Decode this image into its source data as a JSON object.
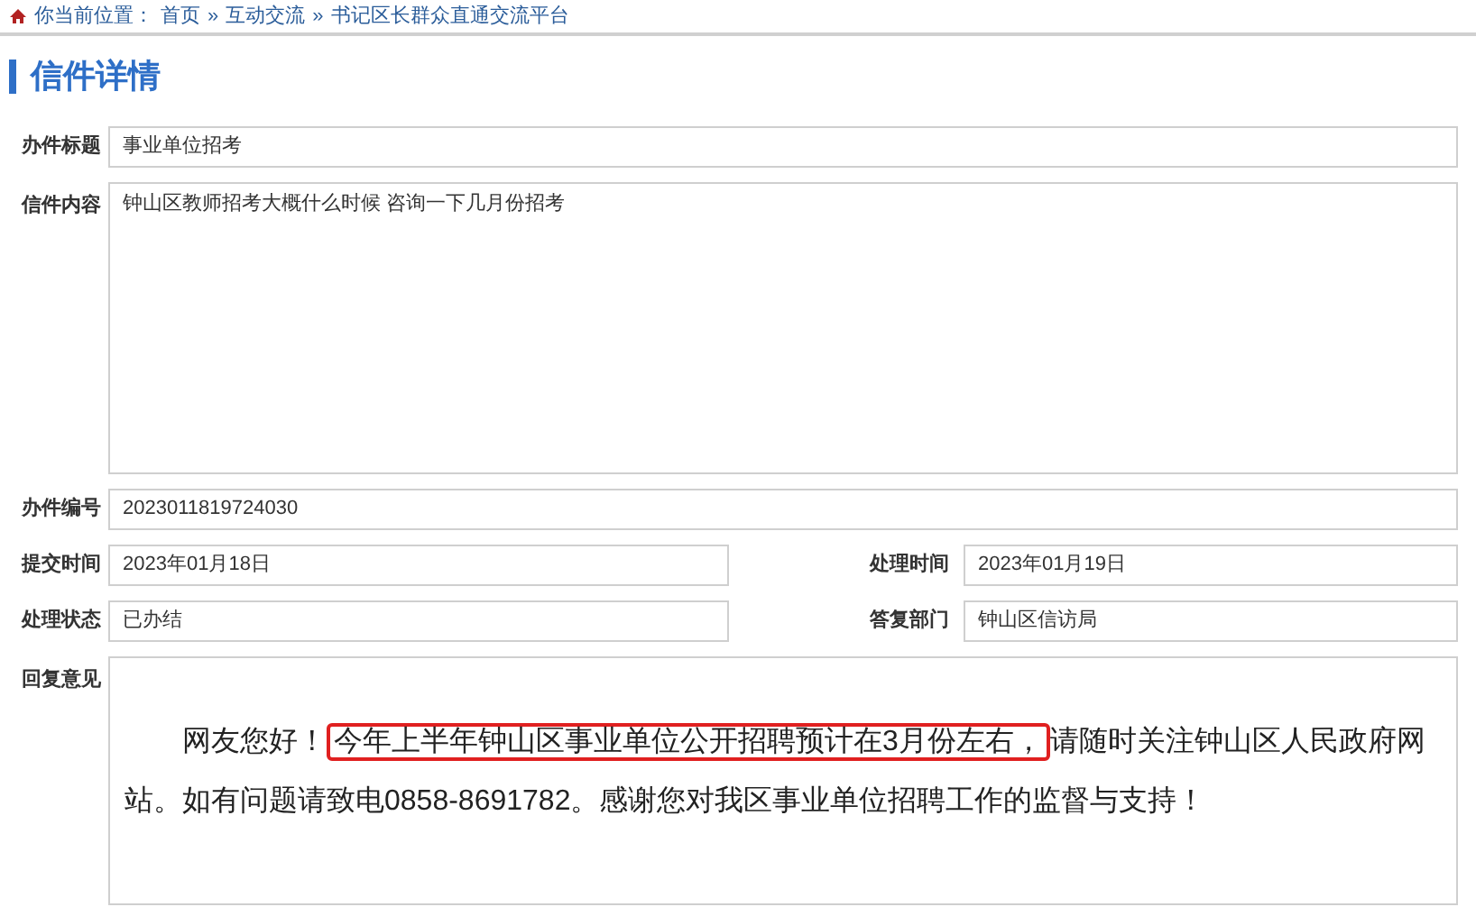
{
  "breadcrumb": {
    "prefix": "你当前位置：",
    "links": [
      "首页",
      "互动交流",
      "书记区长群众直通交流平台"
    ],
    "separator": "»"
  },
  "title": "信件详情",
  "fields": {
    "subject": {
      "label": "办件标题",
      "value": "事业单位招考"
    },
    "content": {
      "label": "信件内容",
      "value": "钟山区教师招考大概什么时候 咨询一下几月份招考"
    },
    "number": {
      "label": "办件编号",
      "value": "2023011819724030"
    },
    "submitted": {
      "label": "提交时间",
      "value": "2023年01月18日"
    },
    "processed": {
      "label": "处理时间",
      "value": "2023年01月19日"
    },
    "status": {
      "label": "处理状态",
      "value": "已办结"
    },
    "department": {
      "label": "答复部门",
      "value": "钟山区信访局"
    }
  },
  "reply": {
    "label": "回复意见",
    "before": "网友您好！",
    "highlighted": "今年上半年钟山区事业单位公开招聘预计在3月份左右，",
    "after": "请随时关注钟山区人民政府网站。如有问题请致电0858-8691782。感谢您对我区事业单位招聘工作的监督与支持！"
  }
}
